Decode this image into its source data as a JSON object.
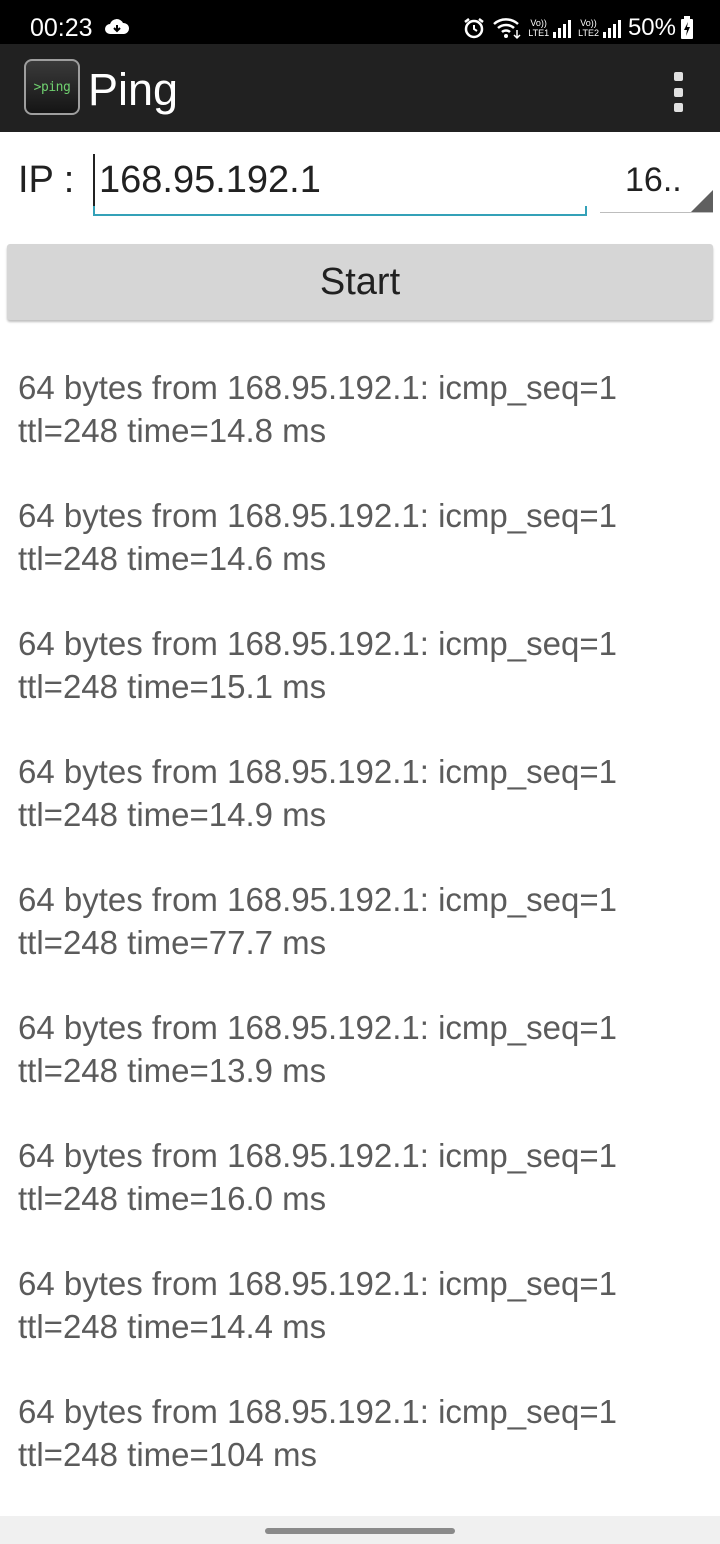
{
  "status_bar": {
    "time": "00:23",
    "sim1_top": "Vo))",
    "sim1_bottom": "LTE1",
    "sim2_top": "Vo))",
    "sim2_bottom": "LTE2",
    "battery": "50%",
    "icons": [
      "cloud-icon",
      "alarm-icon",
      "wifi-icon",
      "signal-icon",
      "battery-charging-icon"
    ]
  },
  "app_bar": {
    "logo_text": ">ping",
    "title": "Ping",
    "menu_icon": "overflow-menu-icon"
  },
  "form": {
    "ip_label": "IP :",
    "ip_value": "168.95.192.1",
    "spinner_value": "16..",
    "start_label": "Start"
  },
  "results": [
    {
      "line1": "64 bytes from 168.95.192.1: icmp_seq=1",
      "line2": "ttl=248 time=14.8 ms"
    },
    {
      "line1": "64 bytes from 168.95.192.1: icmp_seq=1",
      "line2": "ttl=248 time=14.6 ms"
    },
    {
      "line1": "64 bytes from 168.95.192.1: icmp_seq=1",
      "line2": "ttl=248 time=15.1 ms"
    },
    {
      "line1": "64 bytes from 168.95.192.1: icmp_seq=1",
      "line2": "ttl=248 time=14.9 ms"
    },
    {
      "line1": "64 bytes from 168.95.192.1: icmp_seq=1",
      "line2": "ttl=248 time=77.7 ms"
    },
    {
      "line1": "64 bytes from 168.95.192.1: icmp_seq=1",
      "line2": "ttl=248 time=13.9 ms"
    },
    {
      "line1": "64 bytes from 168.95.192.1: icmp_seq=1",
      "line2": "ttl=248 time=16.0 ms"
    },
    {
      "line1": "64 bytes from 168.95.192.1: icmp_seq=1",
      "line2": "ttl=248 time=14.4 ms"
    },
    {
      "line1": "64 bytes from 168.95.192.1: icmp_seq=1",
      "line2": "ttl=248 time=104 ms"
    }
  ],
  "colors": {
    "status_bar": "#000000",
    "app_bar": "#212121",
    "accent": "#34a1b8",
    "button": "#d6d6d6",
    "result_text": "#5b5b5b"
  }
}
